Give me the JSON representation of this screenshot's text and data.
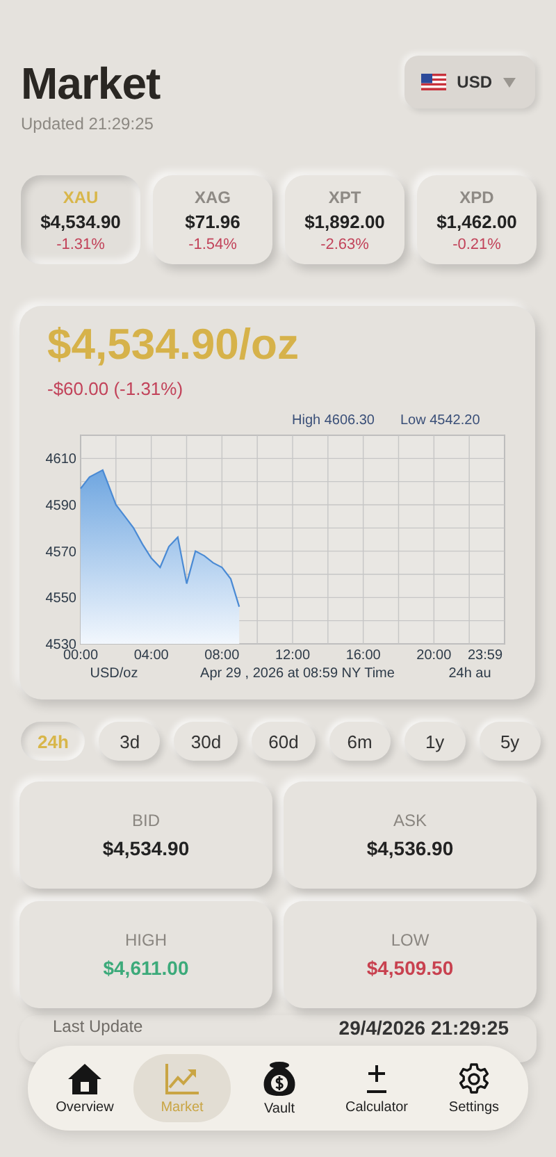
{
  "header": {
    "title": "Market",
    "updated": "Updated 21:29:25",
    "currency": {
      "code": "USD"
    }
  },
  "metals": [
    {
      "symbol": "XAU",
      "price": "$4,534.90",
      "change": "-1.31%",
      "selected": true
    },
    {
      "symbol": "XAG",
      "price": "$71.96",
      "change": "-1.54%",
      "selected": false
    },
    {
      "symbol": "XPT",
      "price": "$1,892.00",
      "change": "-2.63%",
      "selected": false
    },
    {
      "symbol": "XPD",
      "price": "$1,462.00",
      "change": "-0.21%",
      "selected": false
    }
  ],
  "price_card": {
    "price": "$4,534.90/oz",
    "change": "-$60.00 (-1.31%)",
    "chart": {
      "high_label": "High 4606.30",
      "low_label": "Low 4542.20",
      "unit": "USD/oz",
      "timestamp": "Apr 29 , 2026 at 08:59 NY Time",
      "range_note": "24h au",
      "chart_data": {
        "type": "area",
        "grid": true,
        "xlim": [
          0,
          24
        ],
        "ylim": [
          4530,
          4620
        ],
        "xticks": [
          {
            "value": 0,
            "label": "00:00"
          },
          {
            "value": 4,
            "label": "04:00"
          },
          {
            "value": 8,
            "label": "08:00"
          },
          {
            "value": 12,
            "label": "12:00"
          },
          {
            "value": 16,
            "label": "16:00"
          },
          {
            "value": 20,
            "label": "20:00"
          },
          {
            "value": 23.98,
            "label": "23:59"
          }
        ],
        "yticks": [
          4530,
          4550,
          4570,
          4590,
          4610
        ],
        "x": [
          0,
          0.5,
          1,
          1.25,
          1.5,
          2,
          2.5,
          3,
          3.5,
          4,
          4.5,
          5,
          5.5,
          6,
          6.5,
          7,
          7.5,
          8,
          8.5,
          8.98
        ],
        "series": [
          {
            "color": "#4a8ad4",
            "values": [
              4597,
              4602,
              4604,
              4605,
              4600,
              4590,
              4585,
              4580,
              4573,
              4567,
              4563,
              4572,
              4576,
              4556,
              4570,
              4568,
              4565,
              4563,
              4558,
              4546
            ]
          }
        ]
      }
    }
  },
  "ranges": [
    {
      "label": "24h",
      "selected": true
    },
    {
      "label": "3d",
      "selected": false
    },
    {
      "label": "30d",
      "selected": false
    },
    {
      "label": "60d",
      "selected": false
    },
    {
      "label": "6m",
      "selected": false
    },
    {
      "label": "1y",
      "selected": false
    },
    {
      "label": "5y",
      "selected": false
    }
  ],
  "stats": [
    {
      "label": "BID",
      "value": "$4,534.90",
      "color": "#222222"
    },
    {
      "label": "ASK",
      "value": "$4,536.90",
      "color": "#222222"
    },
    {
      "label": "HIGH",
      "value": "$4,611.00",
      "color": "#3caa7a"
    },
    {
      "label": "LOW",
      "value": "$4,509.50",
      "color": "#c8414f"
    }
  ],
  "last_update": {
    "label": "Last Update",
    "value": "29/4/2026 21:29:25"
  },
  "nav": [
    {
      "label": "Overview",
      "kind": "house",
      "selected": false
    },
    {
      "label": "Market",
      "kind": "chart",
      "selected": true
    },
    {
      "label": "Vault",
      "kind": "bag",
      "selected": false
    },
    {
      "label": "Calculator",
      "kind": "plusminus",
      "selected": false
    },
    {
      "label": "Settings",
      "kind": "gear",
      "selected": false
    }
  ]
}
